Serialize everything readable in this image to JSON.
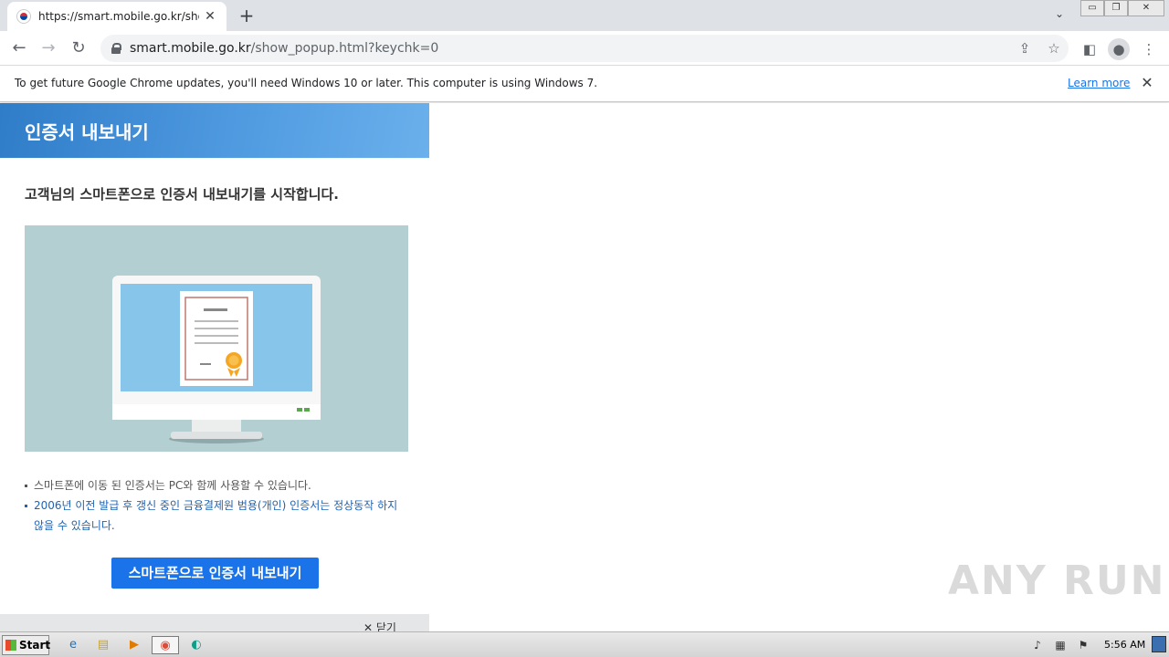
{
  "browser": {
    "tab_title": "https://smart.mobile.go.kr/show_po",
    "new_tab_label": "+",
    "url_host": "smart.mobile.go.kr",
    "url_path": "/show_popup.html?keychk=0"
  },
  "infobar": {
    "message": "To get future Google Chrome updates, you'll need Windows 10 or later. This computer is using Windows 7.",
    "learn_more": "Learn more"
  },
  "popup": {
    "header_title": "인증서 내보내기",
    "intro": "고객님의 스마트폰으로 인증서 내보내기를 시작합니다.",
    "bullets": [
      "스마트폰에 이동 된 인증서는 PC와 함께 사용할 수 있습니다.",
      "2006년 이전 발급 후 갱신 중인 금융결제원 범용(개인) 인증서는 정상동작 하지 않을 수 있습니다."
    ],
    "export_button": "스마트폰으로 인증서 내보내기",
    "close_label": "닫기"
  },
  "watermark": "ANY RUN",
  "taskbar": {
    "start_label": "Start",
    "clock": "5:56 AM"
  },
  "colors": {
    "header_blue": "#2f7cc8",
    "button_blue": "#1a73e8",
    "illustration_bg": "#b3cfd1",
    "screen_blue": "#87c5ea",
    "seal_orange": "#f5a623"
  }
}
